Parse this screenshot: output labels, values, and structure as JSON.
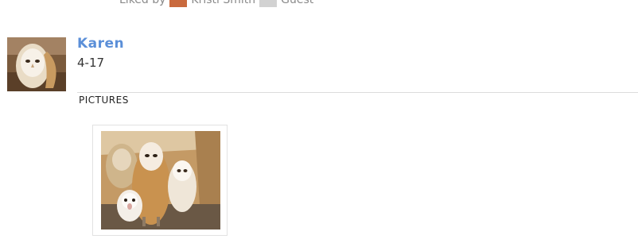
{
  "liked": {
    "prefix": "Liked by",
    "users": [
      "Kristi Smith",
      "Guest"
    ]
  },
  "post": {
    "author": "Karen",
    "date": "4-17",
    "section_label": "PICTURES"
  },
  "colors": {
    "author_link": "#5b8fd8",
    "divider": "#dcdcdc"
  }
}
